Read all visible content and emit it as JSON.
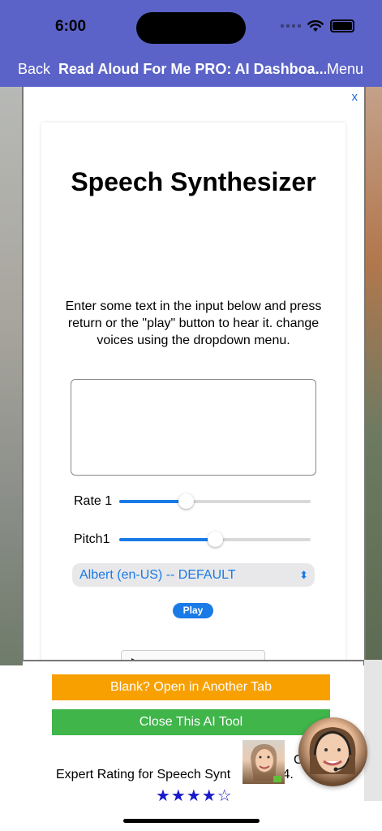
{
  "status_bar": {
    "time": "6:00"
  },
  "nav": {
    "back_label": "Back",
    "title": "Read Aloud For Me PRO: AI Dashboa...",
    "menu_label": "Menu",
    "bar_color": "#5b63c8"
  },
  "modal": {
    "close_label": "x",
    "card": {
      "title": "Speech Synthesizer",
      "description": "Enter some text in the input below and press return or the \"play\" button to hear it. change voices using the dropdown menu.",
      "text_input_value": "",
      "rate": {
        "label": "Rate",
        "value": "1",
        "level": 0.35
      },
      "pitch": {
        "label": "Pitch",
        "value": "1",
        "level": 0.5
      },
      "voice_select": {
        "selected": "Albert (en-US) -- DEFAULT"
      },
      "play_label": "Play",
      "accent_color": "#1a7ae6"
    }
  },
  "actions": {
    "open_tab_label": "Blank? Open in Another Tab",
    "open_tab_color": "#f8a000",
    "close_tool_label": "Close This AI Tool",
    "close_tool_color": "#3fb54a"
  },
  "rating": {
    "text": "Expert Rating for Speech Synt",
    "text_tail": "r: 4.",
    "overlap_letter": "C",
    "stars": "★★★★☆"
  }
}
